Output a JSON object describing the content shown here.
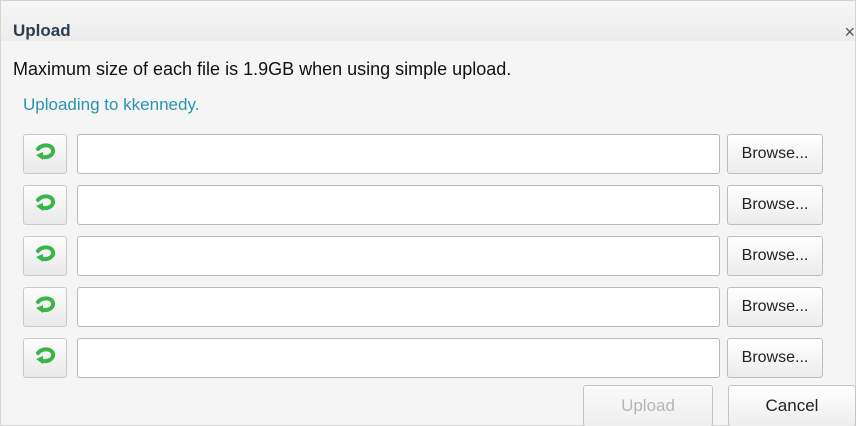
{
  "dialog": {
    "title": "Upload",
    "close_glyph": "×",
    "message": "Maximum size of each file is 1.9GB when using simple upload.",
    "uploading_text": "Uploading to kkennedy."
  },
  "file_rows": [
    {
      "icon": "green-arrow-icon",
      "value": "",
      "browse_label": "Browse..."
    },
    {
      "icon": "green-arrow-icon",
      "value": "",
      "browse_label": "Browse..."
    },
    {
      "icon": "green-arrow-icon",
      "value": "",
      "browse_label": "Browse..."
    },
    {
      "icon": "green-arrow-icon",
      "value": "",
      "browse_label": "Browse..."
    },
    {
      "icon": "green-arrow-icon",
      "value": "",
      "browse_label": "Browse..."
    }
  ],
  "footer": {
    "upload_label": "Upload",
    "upload_enabled": false,
    "cancel_label": "Cancel"
  },
  "colors": {
    "uploading_text": "#2795ad",
    "arrow_icon": "#39b54a",
    "disabled_text": "#b5b5b5"
  }
}
